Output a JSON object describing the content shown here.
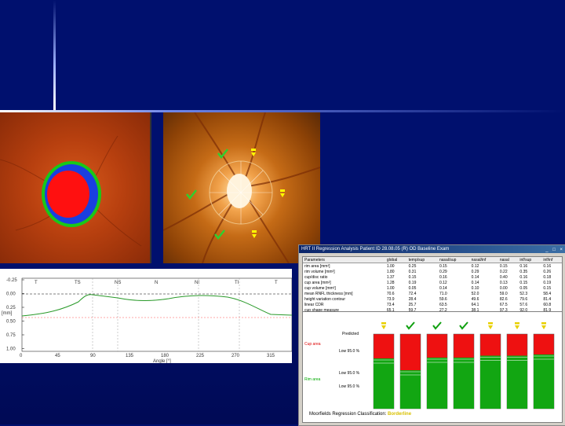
{
  "colors": {
    "background": "#00106e",
    "significant": "#ff0000",
    "normal": "#00aa00",
    "stable": "#ffff00"
  },
  "profile": {
    "sector_labels": [
      "T",
      "TS",
      "NS",
      "N",
      "NI",
      "TI",
      "T"
    ],
    "y_ticks": [
      "-0.25",
      "0.00",
      "0.25",
      "0.50",
      "0.75",
      "1.00"
    ],
    "x_ticks": [
      "0",
      "45",
      "90",
      "135",
      "180",
      "225",
      "270",
      "315"
    ],
    "x_label": "Angle [°]",
    "y_label": "[mm]"
  },
  "regwin": {
    "title": "HRT II  Regression Analysis   Patient ID   28.08.05  (R)  OD   Baseline Exam",
    "columns": [
      "Parameters",
      "global",
      "temp/sup",
      "nasal/sup",
      "nasal/inf",
      "nasal",
      "inf/sup",
      "inf/inf"
    ],
    "rows": [
      [
        "rim area [mm²]",
        "1.00",
        "0.25",
        "0.15",
        "0.12",
        "0.15",
        "0.16",
        "0.16"
      ],
      [
        "rim volume [mm³]",
        "1.80",
        "0.31",
        "0.29",
        "0.29",
        "0.22",
        "0.35",
        "0.26"
      ],
      [
        "cup/disc ratio",
        "1.37",
        "0.15",
        "0.16",
        "0.14",
        "0.40",
        "0.16",
        "0.18"
      ],
      [
        "cup area [mm²]",
        "1.28",
        "0.19",
        "0.12",
        "0.14",
        "0.13",
        "0.15",
        "0.19"
      ],
      [
        "cup volume [mm³]",
        "1.00",
        "0.05",
        "0.14",
        "0.10",
        "0.00",
        "0.05",
        "0.15"
      ],
      [
        "mean RNFL thickness [mm]",
        "70.6",
        "72.4",
        "71.0",
        "52.0",
        "59.0",
        "52.3",
        "58.4"
      ],
      [
        "height variation contour",
        "73.9",
        "28.4",
        "59.6",
        "49.6",
        "82.6",
        "79.6",
        "81.4"
      ],
      [
        "linear CDR",
        "73.4",
        "25.7",
        "63.5",
        "64.1",
        "67.5",
        "57.6",
        "60.8"
      ],
      [
        "cup shape measure",
        "65.1",
        "59.7",
        "27.2",
        "38.1",
        "97.3",
        "92.0",
        "81.9"
      ],
      [
        "max contour elevation",
        "42.5",
        "36.7",
        "26.0",
        "32.0",
        "50.1",
        "42.0",
        "55.5"
      ]
    ],
    "bar_labels": [
      "Predicted",
      "Low 95.0 %",
      "Low 95.0 %",
      "Low 95.0 %"
    ],
    "left_labels": [
      "Cup area",
      "Rim area"
    ],
    "bar_status": [
      "stable-icon",
      "ok-icon",
      "ok-icon",
      "ok-icon",
      "stable-icon",
      "stable-icon",
      "stable-icon"
    ],
    "footer": "Moorfields Regression Classification:",
    "footer_value": "Borderline"
  }
}
